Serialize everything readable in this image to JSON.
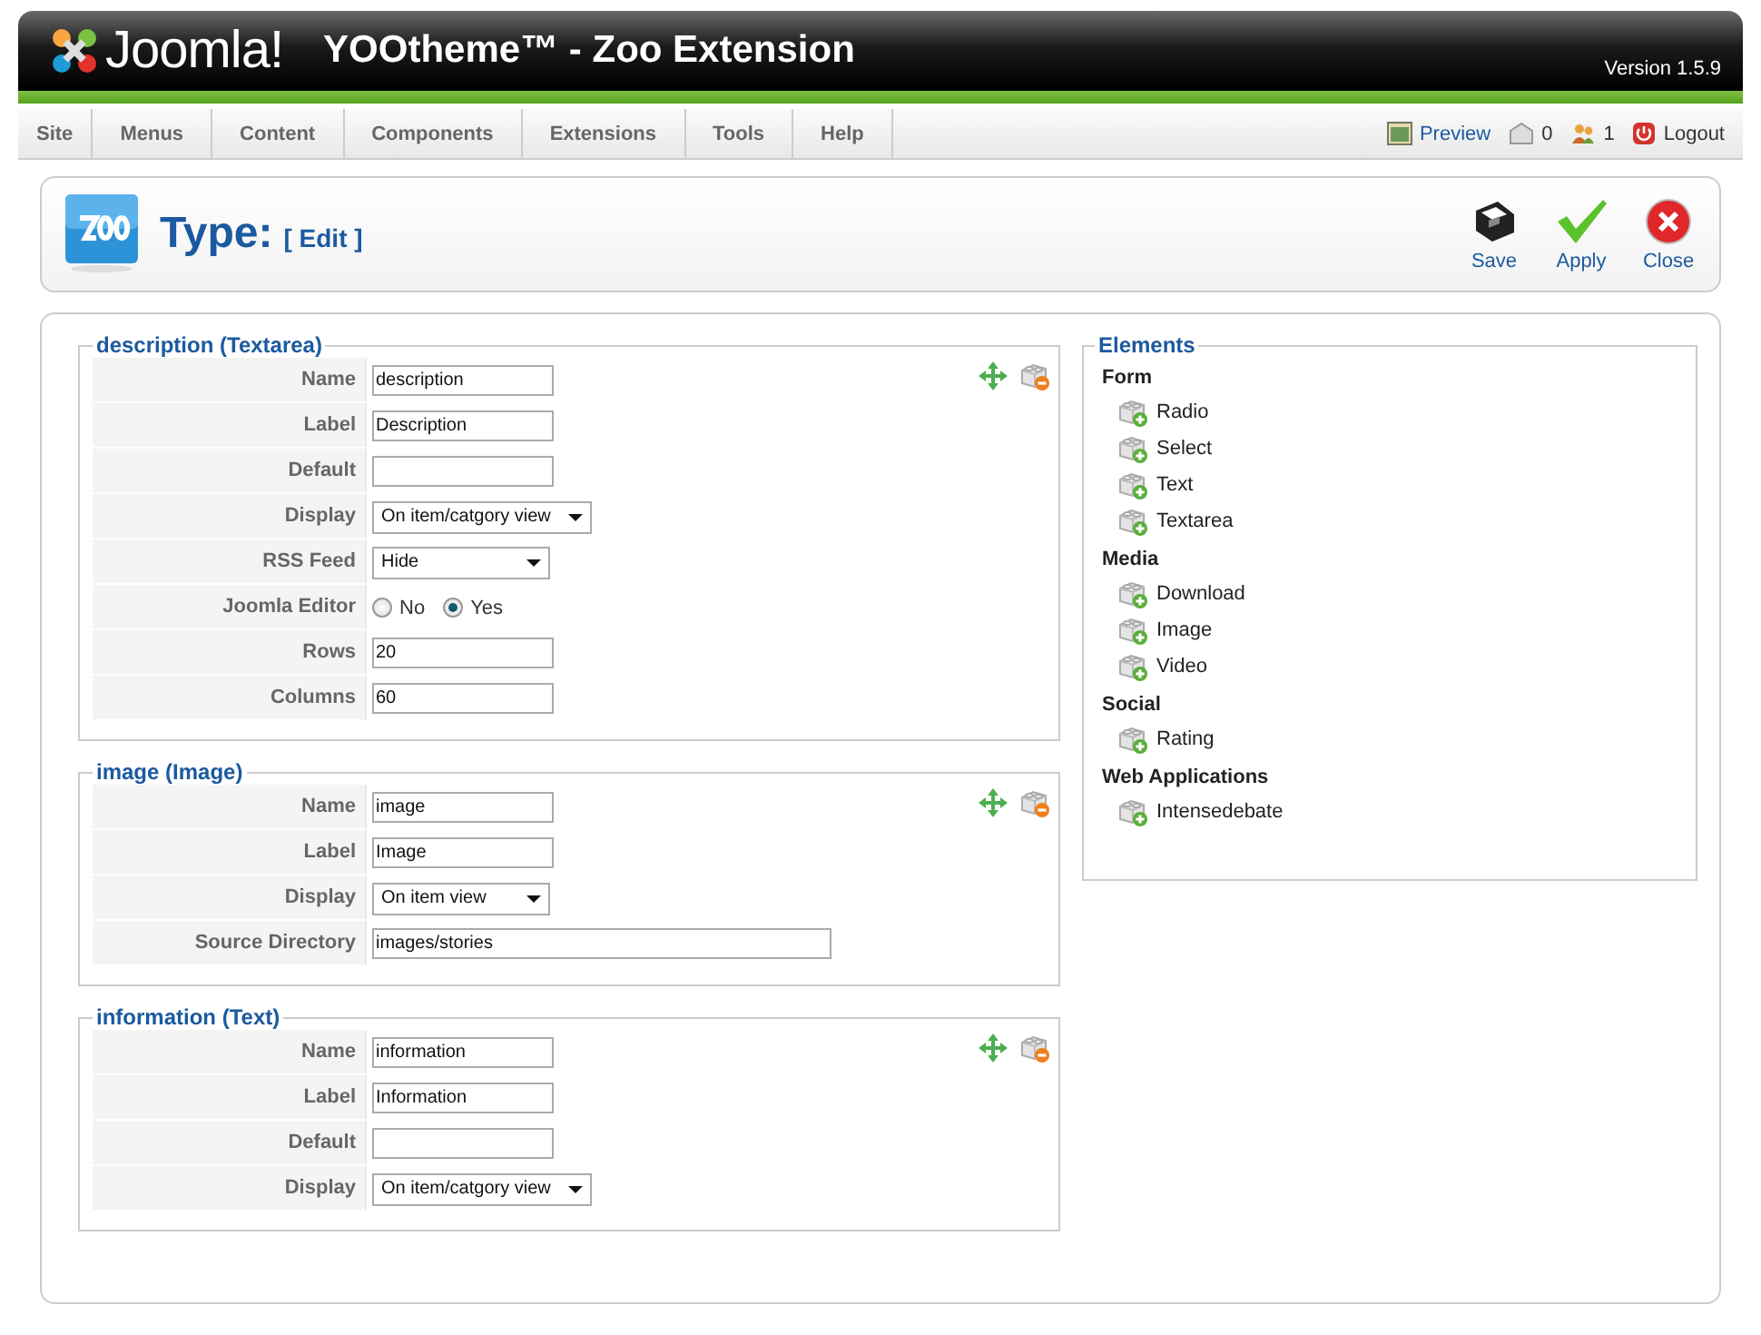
{
  "header": {
    "logo": "Joomla!",
    "title": "YOOtheme™ - Zoo Extension",
    "version": "Version 1.5.9"
  },
  "menu": [
    {
      "label": "Site"
    },
    {
      "label": "Menus"
    },
    {
      "label": "Content"
    },
    {
      "label": "Components"
    },
    {
      "label": "Extensions"
    },
    {
      "label": "Tools"
    },
    {
      "label": "Help"
    }
  ],
  "status": {
    "preview": "Preview",
    "messages": "0",
    "users": "1",
    "logout": "Logout"
  },
  "toolbar": {
    "title": "Type:",
    "subtitle": "[ Edit ]",
    "buttons": [
      {
        "kind": "save",
        "label": "Save"
      },
      {
        "kind": "apply",
        "label": "Apply"
      },
      {
        "kind": "close",
        "label": "Close"
      }
    ]
  },
  "sections": [
    {
      "title": "description (Textarea)",
      "fields": [
        {
          "label": "Name",
          "kind": "text",
          "value": "description"
        },
        {
          "label": "Label",
          "kind": "text",
          "value": "Description"
        },
        {
          "label": "Default",
          "kind": "text"
        },
        {
          "label": "Display",
          "kind": "select",
          "value": "On item/catgory view"
        },
        {
          "label": "RSS Feed",
          "kind": "select",
          "value": "Hide"
        },
        {
          "label": "Joomla Editor",
          "kind": "radio",
          "options": [
            {
              "label": "No",
              "selected": false
            },
            {
              "label": "Yes",
              "selected": true
            }
          ]
        },
        {
          "label": "Rows",
          "kind": "text",
          "value": "20"
        },
        {
          "label": "Columns",
          "kind": "text",
          "value": "60"
        }
      ]
    },
    {
      "title": "image (Image)",
      "fields": [
        {
          "label": "Name",
          "kind": "text",
          "value": "image"
        },
        {
          "label": "Label",
          "kind": "text",
          "value": "Image"
        },
        {
          "label": "Display",
          "kind": "select",
          "value": "On item view"
        },
        {
          "label": "Source Directory",
          "kind": "wide_text",
          "value": "images/stories"
        }
      ]
    },
    {
      "title": "information (Text)",
      "fields": [
        {
          "label": "Name",
          "kind": "text",
          "value": "information"
        },
        {
          "label": "Label",
          "kind": "text",
          "value": "Information"
        },
        {
          "label": "Default",
          "kind": "text"
        },
        {
          "label": "Display",
          "kind": "select",
          "value": "On item/catgory view"
        }
      ]
    }
  ],
  "elements": {
    "title": "Elements",
    "groups": [
      {
        "name": "Form",
        "items": [
          "Radio",
          "Select",
          "Text",
          "Textarea"
        ]
      },
      {
        "name": "Media",
        "items": [
          "Download",
          "Image",
          "Video"
        ]
      },
      {
        "name": "Social",
        "items": [
          "Rating"
        ]
      },
      {
        "name": "Web Applications",
        "items": [
          "Intensedebate"
        ]
      }
    ]
  }
}
